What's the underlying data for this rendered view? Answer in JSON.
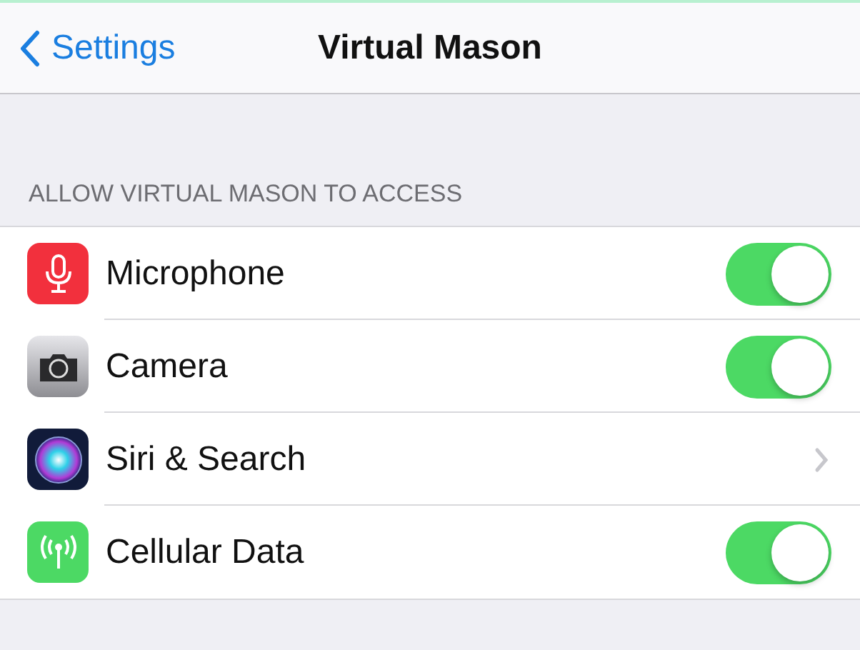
{
  "nav": {
    "back": "Settings",
    "title": "Virtual Mason"
  },
  "section": {
    "header": "ALLOW VIRTUAL MASON TO ACCESS",
    "rows": [
      {
        "label": "Microphone",
        "kind": "toggle",
        "on": true
      },
      {
        "label": "Camera",
        "kind": "toggle",
        "on": true
      },
      {
        "label": "Siri & Search",
        "kind": "link"
      },
      {
        "label": "Cellular Data",
        "kind": "toggle",
        "on": true
      }
    ]
  }
}
